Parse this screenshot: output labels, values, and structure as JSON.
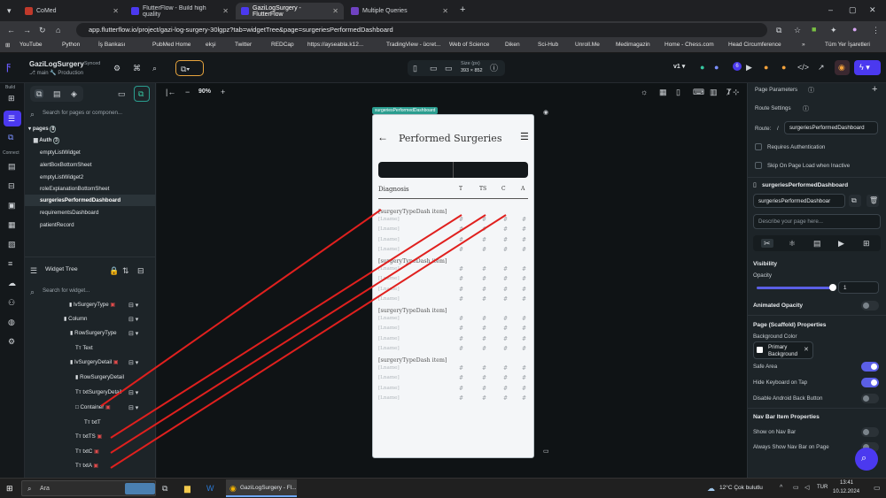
{
  "browser": {
    "tabs": [
      {
        "label": "CoMed"
      },
      {
        "label": "FlutterFlow - Build high quality"
      },
      {
        "label": "GaziLogSurgery - FlutterFlow"
      },
      {
        "label": "Multiple Queries"
      }
    ],
    "new_tab": "+",
    "url": "app.flutterflow.io/project/gazi-log-surgery-30lgpz?tab=widgetTree&page=surgeriesPerformedDashboard",
    "bookmarks": [
      "YouTube",
      "Python",
      "İş Bankası",
      "PubMed Home",
      "ekşi",
      "Twitter",
      "REDCap",
      "https://ayseabla.k12...",
      "TradingView - ücret...",
      "Web of Science",
      "Diken",
      "Sci-Hub",
      "Unroll.Me",
      "Medimagazin",
      "Home - Chess.com",
      "Head Circumference",
      "Tüm Yer İşaretleri"
    ]
  },
  "topbar": {
    "project_name": "GaziLogSurgery",
    "synced": "Synced",
    "branch": "main",
    "env": "Production",
    "size_label": "Size (px)",
    "size_value": "393 × 852",
    "version": "v1",
    "notif_count": "6"
  },
  "rail": {
    "build": "Build",
    "connect": "Connect"
  },
  "left_panel": {
    "search_pages_placeholder": "Search for pages or componen...",
    "pages_label": "pages",
    "pages_count": "8",
    "auth_label": "Auth",
    "auth_count": "3",
    "pages": [
      "emptyListWidget",
      "alertBoxBottomSheet",
      "emptyListWidget2",
      "roleExplanationBottomSheet",
      "surgeriesPerformedDashboard",
      "requirementsDashboard",
      "patientRecord"
    ],
    "widget_tree_label": "Widget Tree",
    "search_widget_placeholder": "Search for widget...",
    "tree": [
      {
        "label": "lvSurgeryType",
        "indent": 0
      },
      {
        "label": "Column",
        "indent": 1
      },
      {
        "label": "RowSurgeryType",
        "indent": 2
      },
      {
        "label": "Text",
        "indent": 3
      },
      {
        "label": "lvSurgeryDetail",
        "indent": 2
      },
      {
        "label": "RowSurgeryDetail",
        "indent": 3
      },
      {
        "label": "txtSurgeryDetail",
        "indent": 4
      },
      {
        "label": "Container",
        "indent": 4
      },
      {
        "label": "txtT",
        "indent": 5
      },
      {
        "label": "txtTS",
        "indent": 4
      },
      {
        "label": "txtC",
        "indent": 4
      },
      {
        "label": "txtA",
        "indent": 4
      }
    ]
  },
  "canvas": {
    "zoom": "90%",
    "page_tag": "surgeriesPerformedDashboard",
    "appbar_title": "Performed Surgeries",
    "table_header": [
      "Diagnosis",
      "T",
      "TS",
      "C",
      "A"
    ],
    "groups": [
      {
        "title": "[surgeryTypeDash item]",
        "rows": [
          "[Lname]",
          "[Lname]",
          "[Lname]",
          "[Lname]"
        ]
      },
      {
        "title": "[surgeryTypeDash item]",
        "rows": [
          "[Lname]",
          "[Lname]",
          "[Lname]",
          "[Lname]"
        ]
      },
      {
        "title": "[surgeryTypeDash item]",
        "rows": [
          "[Lname]",
          "[Lname]",
          "[Lname]",
          "[Lname]"
        ]
      },
      {
        "title": "[surgeryTypeDash item]",
        "rows": [
          "[Lname]",
          "[Lname]",
          "[Lname]",
          "[Lname]"
        ]
      }
    ],
    "hash": "#",
    "accent": "#2a9d8f",
    "annotation_color": "#e0201e"
  },
  "right_panel": {
    "page_params": "Page Parameters",
    "route_settings": "Route Settings",
    "route_label": "Route:",
    "route_slash": "/",
    "route_value": "surgeriesPerformedDashboard",
    "requires_auth": "Requires Authentication",
    "skip_on_load": "Skip On Page Load when Inactive",
    "page_name_title": "surgeriesPerformedDashboard",
    "page_name_value": "surgeriesPerformedDashboar",
    "describe_placeholder": "Describe your page here...",
    "visibility": "Visibility",
    "opacity_label": "Opacity",
    "opacity_value": "1",
    "opacity_level": 1.0,
    "animated_opacity": "Animated Opacity",
    "scaffold_props": "Page (Scaffold) Properties",
    "bg_color_label": "Background Color",
    "bg_color_value": "Primary Background",
    "safe_area": "Safe Area",
    "hide_keyboard": "Hide Keyboard on Tap",
    "disable_back": "Disable Android Back Button",
    "nav_bar_props": "Nav Bar Item Properties",
    "show_nav": "Show on Nav Bar",
    "always_show": "Always Show Nav Bar on Page",
    "toggle_on_color": "#5b5fe6"
  },
  "taskbar": {
    "search_placeholder": "Ara",
    "active_app": "GaziLogSurgery - Fl...",
    "weather": "12°C  Çok bulutlu",
    "lang": "TUR",
    "time": "13:41",
    "date": "10.12.2024"
  }
}
